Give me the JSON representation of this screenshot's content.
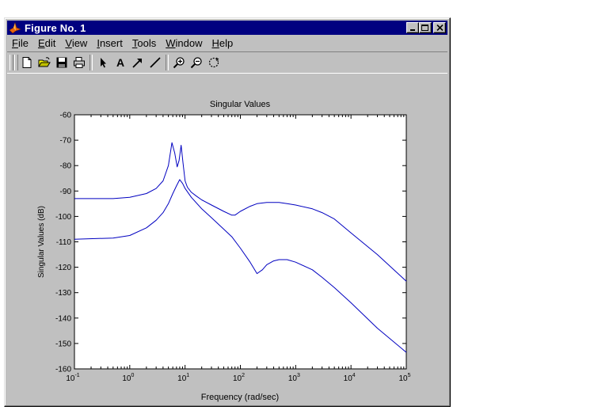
{
  "window": {
    "title": "Figure No. 1",
    "controls": {
      "minimize": "minimize",
      "maximize": "maximize",
      "close": "close"
    }
  },
  "menu": {
    "items": [
      {
        "label": "File",
        "mnemonic": "F"
      },
      {
        "label": "Edit",
        "mnemonic": "E"
      },
      {
        "label": "View",
        "mnemonic": "V"
      },
      {
        "label": "Insert",
        "mnemonic": "I"
      },
      {
        "label": "Tools",
        "mnemonic": "T"
      },
      {
        "label": "Window",
        "mnemonic": "W"
      },
      {
        "label": "Help",
        "mnemonic": "H"
      }
    ]
  },
  "toolbar": {
    "icons": [
      "new-file-icon",
      "open-folder-icon",
      "save-icon",
      "print-icon",
      "select-arrow-icon",
      "text-icon",
      "arrow-icon",
      "line-icon",
      "zoom-in-icon",
      "zoom-out-icon",
      "rotate-icon"
    ]
  },
  "colors": {
    "window_bg": "#c0c0c0",
    "titlebar": "#000080",
    "line": "#0000c0"
  },
  "chart_data": {
    "type": "line",
    "title": "Singular Values",
    "xlabel": "Frequency (rad/sec)",
    "ylabel": "Singular Values (dB)",
    "xscale": "log",
    "xlim": [
      0.1,
      100000
    ],
    "ylim": [
      -160,
      -60
    ],
    "xticks": [
      {
        "base": "10",
        "exp": "-1"
      },
      {
        "base": "10",
        "exp": "0"
      },
      {
        "base": "10",
        "exp": "1"
      },
      {
        "base": "10",
        "exp": "2"
      },
      {
        "base": "10",
        "exp": "3"
      },
      {
        "base": "10",
        "exp": "4"
      },
      {
        "base": "10",
        "exp": "5"
      }
    ],
    "yticks": [
      "-60",
      "-70",
      "-80",
      "-90",
      "-100",
      "-110",
      "-120",
      "-130",
      "-140",
      "-150",
      "-160"
    ],
    "grid": false,
    "series": [
      {
        "x": [
          0.1,
          0.5,
          1,
          2,
          3,
          4,
          5,
          5.8,
          6.5,
          7.2,
          7.8,
          8.5,
          9.2,
          10,
          11,
          13,
          16,
          20,
          30,
          50,
          70,
          80,
          100,
          150,
          200,
          300,
          500,
          700,
          1000,
          2000,
          3000,
          5000,
          10000,
          30000,
          100000
        ],
        "y": [
          -93,
          -93,
          -92.5,
          -91,
          -89,
          -86,
          -80,
          -71,
          -75,
          -80.5,
          -78,
          -72,
          -79,
          -86,
          -88.5,
          -90.5,
          -92,
          -93.5,
          -95.5,
          -98,
          -99.5,
          -99.5,
          -98,
          -96,
          -95,
          -94.5,
          -94.5,
          -95,
          -95.5,
          -97,
          -98.5,
          -101,
          -106.5,
          -115,
          -125.5
        ]
      },
      {
        "x": [
          0.1,
          0.5,
          1,
          2,
          3,
          4,
          5,
          6,
          7,
          8,
          9,
          10,
          13,
          20,
          30,
          50,
          70,
          100,
          150,
          200,
          250,
          300,
          400,
          500,
          700,
          1000,
          2000,
          3000,
          5000,
          10000,
          30000,
          100000
        ],
        "y": [
          -109,
          -108.5,
          -107.5,
          -104.5,
          -101.5,
          -98.5,
          -95,
          -91,
          -88,
          -85.5,
          -87,
          -89,
          -92.5,
          -97,
          -100.5,
          -105,
          -108,
          -112.5,
          -118,
          -122.5,
          -121,
          -119,
          -117.5,
          -117,
          -117,
          -118,
          -121,
          -124,
          -128,
          -134,
          -144,
          -153.5
        ]
      }
    ]
  }
}
